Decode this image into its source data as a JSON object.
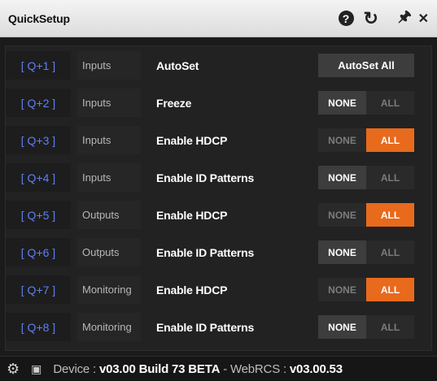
{
  "window": {
    "title": "QuickSetup"
  },
  "titlebar_icons": [
    "help-icon",
    "refresh-icon",
    "pin-icon",
    "close-icon"
  ],
  "rows": [
    {
      "key": "[ Q+1 ]",
      "category": "Inputs",
      "label": "AutoSet",
      "control": "button",
      "button_label": "AutoSet All"
    },
    {
      "key": "[ Q+2 ]",
      "category": "Inputs",
      "label": "Freeze",
      "control": "toggle",
      "none_label": "NONE",
      "all_label": "ALL",
      "selected": "NONE"
    },
    {
      "key": "[ Q+3 ]",
      "category": "Inputs",
      "label": "Enable HDCP",
      "control": "toggle",
      "none_label": "NONE",
      "all_label": "ALL",
      "selected": "ALL"
    },
    {
      "key": "[ Q+4 ]",
      "category": "Inputs",
      "label": "Enable ID Patterns",
      "control": "toggle",
      "none_label": "NONE",
      "all_label": "ALL",
      "selected": "NONE"
    },
    {
      "key": "[ Q+5 ]",
      "category": "Outputs",
      "label": "Enable HDCP",
      "control": "toggle",
      "none_label": "NONE",
      "all_label": "ALL",
      "selected": "ALL"
    },
    {
      "key": "[ Q+6 ]",
      "category": "Outputs",
      "label": "Enable ID Patterns",
      "control": "toggle",
      "none_label": "NONE",
      "all_label": "ALL",
      "selected": "NONE"
    },
    {
      "key": "[ Q+7 ]",
      "category": "Monitoring",
      "label": "Enable HDCP",
      "control": "toggle",
      "none_label": "NONE",
      "all_label": "ALL",
      "selected": "ALL"
    },
    {
      "key": "[ Q+8 ]",
      "category": "Monitoring",
      "label": "Enable ID Patterns",
      "control": "toggle",
      "none_label": "NONE",
      "all_label": "ALL",
      "selected": "NONE"
    }
  ],
  "footer": {
    "device_label": "Device :",
    "device_value": "v03.00 Build 73 BETA",
    "separator": "-",
    "webrcs_label": "WebRCS :",
    "webrcs_value": "v03.00.53"
  },
  "colors": {
    "key_blue": "#5f7ff2",
    "accent_orange": "#e86a1c",
    "selected_gray": "#3d3d3d"
  }
}
